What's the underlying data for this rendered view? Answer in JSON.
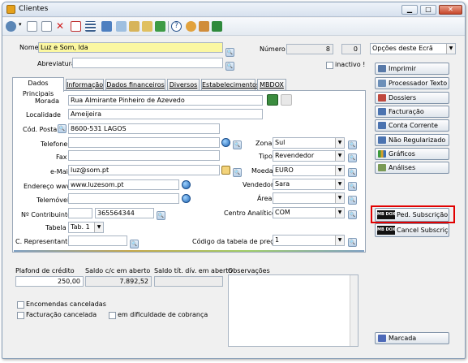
{
  "window": {
    "title": "Clientes"
  },
  "toolbar": {
    "icons": [
      "circle-menu-icon",
      "new-record-icon",
      "new-document-icon",
      "delete-icon",
      "delete-red-icon",
      "grid-icon",
      "open-folder-icon",
      "search-record-icon",
      "open-icon",
      "export-icon",
      "help-icon",
      "settings-icon",
      "exit-icon"
    ]
  },
  "header": {
    "nome_label": "Nome",
    "nome_value": "Luz e Som, lda",
    "numero_label": "Número",
    "numero_value": "8",
    "numero_extra": "0",
    "abreviatura_label": "Abreviatura",
    "abreviatura_value": "",
    "inactivo_label": "inactivo !",
    "opcoes_label": "Opções deste Ecrã"
  },
  "tabs": [
    "Dados Principais",
    "Informação",
    "Dados financeiros",
    "Diversos",
    "Estabelecimentos",
    "MBDOX"
  ],
  "form": {
    "morada_label": "Morada",
    "morada_value": "Rua Almirante Pinheiro de Azevedo",
    "localidade_label": "Localidade",
    "localidade_value": "Ameijeira",
    "codpostal_label": "Cód. Postal",
    "codpostal_value": "8600-531 LAGOS",
    "telefone_label": "Telefone",
    "telefone_value": "",
    "fax_label": "Fax",
    "fax_value": "",
    "email_label": "e-Mail",
    "email_value": "luz@som.pt",
    "www_label": "Endereço www",
    "www_value": "www.luzesom.pt",
    "telemovel_label": "Telemóvel",
    "telemovel_value": "",
    "contribuinte_label": "Nº Contribuinte",
    "contribuinte_value": "365564344",
    "tabela_label": "Tabela",
    "tabela_value": "Tab. 1",
    "representante_label": "C. Representante",
    "representante_value": "",
    "zona_label": "Zona",
    "zona_value": "Sul",
    "tipo_label": "Tipo",
    "tipo_value": "Revendedor",
    "moeda_label": "Moeda",
    "moeda_value": "EURO",
    "vendedor_label": "Vendedor",
    "vendedor_value": "Sara",
    "area_label": "Área",
    "area_value": "",
    "analitico_label": "Centro Analítico",
    "analitico_value": "COM",
    "codtabela_label": "Código da tabela de preços",
    "codtabela_value": "1"
  },
  "finance": {
    "plafond_label": "Plafond de crédito",
    "plafond_value": "250,00",
    "saldo_label": "Saldo c/c em aberto",
    "saldo_value": "7.892,52",
    "saldo_tit_label": "Saldo tít. dív. em aberto",
    "saldo_tit_value": "",
    "obs_label": "Observações"
  },
  "checks": {
    "encomendas": "Encomendas canceladas",
    "facturacao": "Facturação cancelada",
    "dificuldade": "em dificuldade de cobrança"
  },
  "sidebar": {
    "items": [
      "Imprimir",
      "Processador Texto",
      "Dossiers",
      "Facturação",
      "Conta Corrente",
      "Não Regularizado",
      "Gráficos",
      "Análises"
    ],
    "ped_subscricao": "Ped. Subscrição",
    "cancel_subscricao": "Cancel Subscrição",
    "mb_logo": "MB DOX",
    "marcada": "Marcada"
  }
}
